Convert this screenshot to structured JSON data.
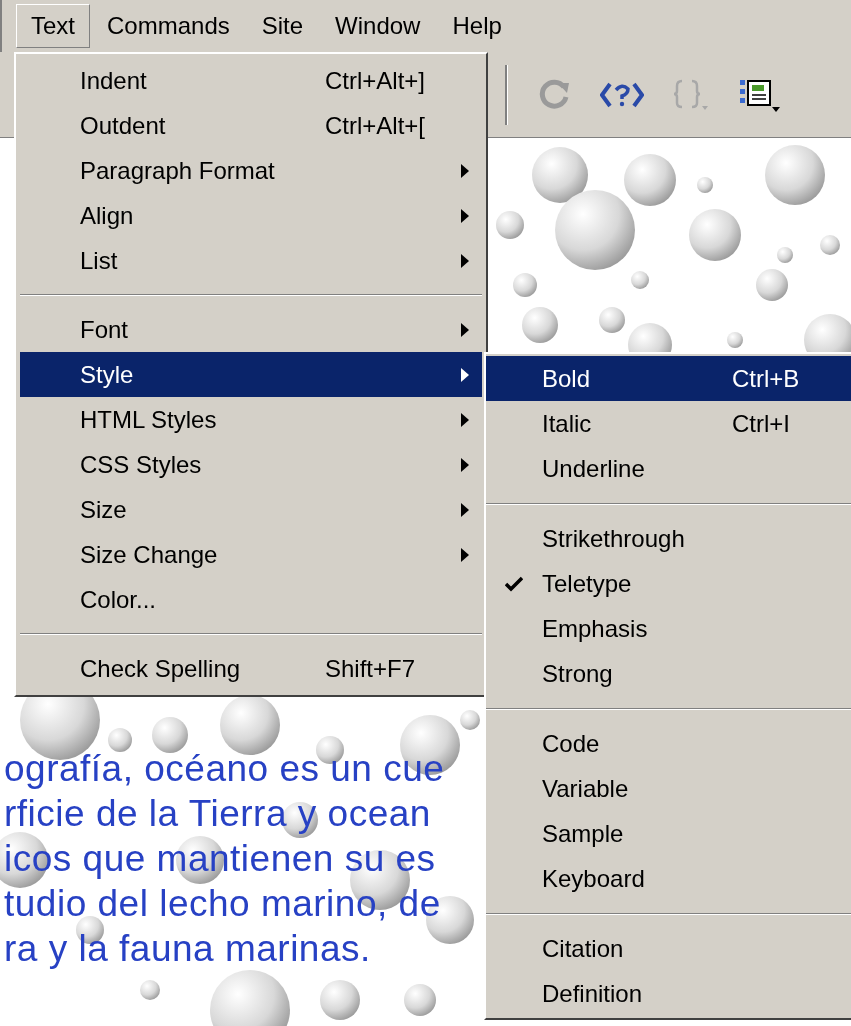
{
  "menubar": [
    {
      "label": "Text",
      "selected": true
    },
    {
      "label": "Commands",
      "selected": false
    },
    {
      "label": "Site",
      "selected": false
    },
    {
      "label": "Window",
      "selected": false
    },
    {
      "label": "Help",
      "selected": false
    }
  ],
  "text_menu": {
    "items": [
      {
        "kind": "item",
        "label": "Indent",
        "shortcut": "Ctrl+Alt+]",
        "selected": false
      },
      {
        "kind": "item",
        "label": "Outdent",
        "shortcut": "Ctrl+Alt+[",
        "selected": false
      },
      {
        "kind": "submenu",
        "label": "Paragraph Format",
        "selected": false
      },
      {
        "kind": "submenu",
        "label": "Align",
        "selected": false
      },
      {
        "kind": "submenu",
        "label": "List",
        "selected": false
      },
      {
        "kind": "separator"
      },
      {
        "kind": "submenu",
        "label": "Font",
        "selected": false
      },
      {
        "kind": "submenu",
        "label": "Style",
        "selected": true
      },
      {
        "kind": "submenu",
        "label": "HTML Styles",
        "selected": false
      },
      {
        "kind": "submenu",
        "label": "CSS Styles",
        "selected": false
      },
      {
        "kind": "submenu",
        "label": "Size",
        "selected": false
      },
      {
        "kind": "submenu",
        "label": "Size Change",
        "selected": false
      },
      {
        "kind": "item",
        "label": "Color...",
        "selected": false
      },
      {
        "kind": "separator"
      },
      {
        "kind": "item",
        "label": "Check Spelling",
        "shortcut": "Shift+F7",
        "selected": false
      }
    ]
  },
  "style_submenu": {
    "items": [
      {
        "kind": "item",
        "label": "Bold",
        "shortcut": "Ctrl+B",
        "selected": true,
        "checked": false
      },
      {
        "kind": "item",
        "label": "Italic",
        "shortcut": "Ctrl+I",
        "selected": false,
        "checked": false
      },
      {
        "kind": "item",
        "label": "Underline",
        "selected": false,
        "checked": false
      },
      {
        "kind": "separator"
      },
      {
        "kind": "item",
        "label": "Strikethrough",
        "selected": false,
        "checked": false
      },
      {
        "kind": "item",
        "label": "Teletype",
        "selected": false,
        "checked": true
      },
      {
        "kind": "item",
        "label": "Emphasis",
        "selected": false,
        "checked": false
      },
      {
        "kind": "item",
        "label": "Strong",
        "selected": false,
        "checked": false
      },
      {
        "kind": "separator"
      },
      {
        "kind": "item",
        "label": "Code",
        "selected": false,
        "checked": false
      },
      {
        "kind": "item",
        "label": "Variable",
        "selected": false,
        "checked": false
      },
      {
        "kind": "item",
        "label": "Sample",
        "selected": false,
        "checked": false
      },
      {
        "kind": "item",
        "label": "Keyboard",
        "selected": false,
        "checked": false
      },
      {
        "kind": "separator"
      },
      {
        "kind": "item",
        "label": "Citation",
        "selected": false,
        "checked": false
      },
      {
        "kind": "item",
        "label": "Definition",
        "selected": false,
        "checked": false
      }
    ]
  },
  "document": {
    "lines": [
      "ografía, océano es un cue",
      "rficie de la Tierra y ocean",
      "icos que mantienen su es",
      "tudio del lecho marino, de",
      "ra y la fauna marinas."
    ]
  }
}
